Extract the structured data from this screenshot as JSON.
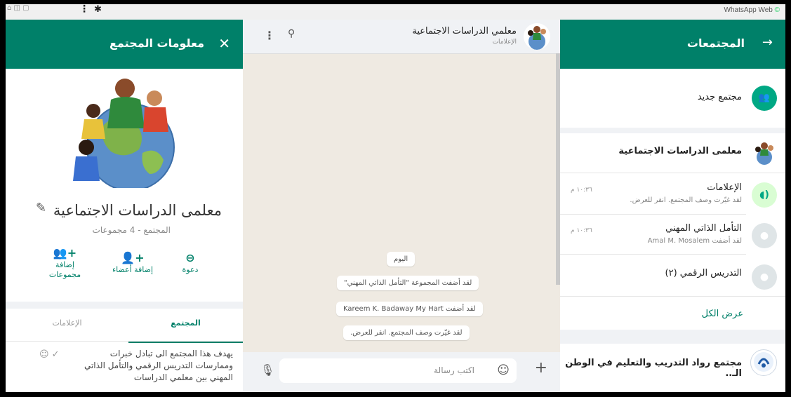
{
  "window": {
    "title": "WhatsApp Web",
    "status_glyph": "©"
  },
  "browser": {
    "tab_icons": "⌂ ◫ ▢",
    "menu_glyph": "⋮",
    "extensions_glyph": "✱"
  },
  "left_panel": {
    "header_title": "معلومات المجتمع",
    "close_glyph": "✕",
    "community_name": "معلمى الدراسات الاجتماعية",
    "edit_glyph": "✎",
    "subtitle": "المجتمع - 4 مجموعات",
    "actions": [
      {
        "label": "دعوة",
        "glyph": "⊖"
      },
      {
        "label": "إضافة أعضاء",
        "glyph": "+👤"
      },
      {
        "label": "إضافة مجموعات",
        "glyph": "+👥"
      }
    ],
    "tabs": [
      {
        "label": "المجتمع",
        "active": true
      },
      {
        "label": "الإعلامات",
        "active": false
      }
    ],
    "description": "يهدف هذا المجتمع الى تبادل خبرات وممارسات التدريس الرقمي والتأمل الذاتي المهني بين معلمي الدراسات",
    "desc_icons": "☺ ✓"
  },
  "chat": {
    "group_name": "معلمي الدراسات الاجتماعية",
    "group_sub": "الإعلامات",
    "menu_glyph": "⋮",
    "search_glyph": "⚲",
    "messages": [
      "اليوم",
      "لقد أضفت المجموعة \"التأمل الذاتي المهني\"",
      "لقد أضفت Kareem K. Badaway My Hart",
      "لقد غيّرت وصف المجتمع. انقر للعرض."
    ],
    "input_placeholder": "اكتب رسالة",
    "mic_glyph": "🎙",
    "emoji_glyph": "☺",
    "plus_glyph": "+"
  },
  "right_panel": {
    "header_title": "المجتمعات",
    "back_glyph": "→",
    "new_community": "مجتمع جديد",
    "community_name": "معلمى الدراسات الاجتماعية",
    "groups": [
      {
        "name": "الإعلامات",
        "sub": "لقد غيّرت وصف المجتمع. انقر للعرض.",
        "time": "١٠:٣٦ م"
      },
      {
        "name": "التأمل الذاتي المهني",
        "sub": "لقد أضفت Amal M. Mosalem",
        "time": "١٠:٣٦ م"
      },
      {
        "name": "التدريس الرقمي (٢)",
        "sub": "",
        "time": ""
      }
    ],
    "see_all": "عرض الكل",
    "other_community": "مجتمع رواد التدريب والتعليم في الوطن الـ.."
  },
  "colors": {
    "accent": "#008069",
    "chat_bg": "#efeae2",
    "panel_bg": "#f0f2f5"
  }
}
